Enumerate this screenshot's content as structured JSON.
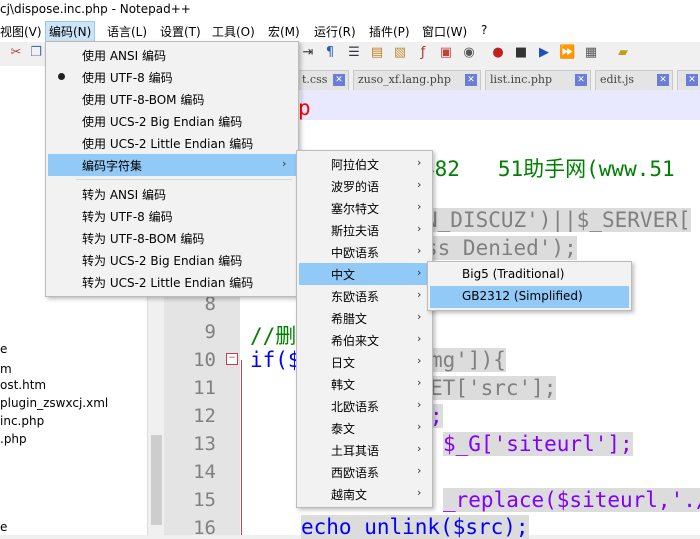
{
  "window": {
    "title": "cj\\dispose.inc.php - Notepad++"
  },
  "menubar": [
    "视图(V)",
    "编码(N)",
    "语言(L)",
    "设置(T)",
    "工具(O)",
    "宏(M)",
    "运行(R)",
    "插件(P)",
    "窗口(W)",
    "?"
  ],
  "tabs": [
    "t.css",
    "zuso_xf.lang.php",
    "list.inc.php",
    "edit.js"
  ],
  "sidebar_files": [
    "e",
    "m",
    "ost.htm",
    "plugin_zswxcj.xml",
    "inc.php",
    ".php",
    "e"
  ],
  "line_numbers": [
    "8",
    "9",
    "10",
    "11",
    "12",
    "13",
    "14",
    "15",
    "16"
  ],
  "code": {
    "l_p": "p",
    "l_482": "482   51助手网(www.51",
    "l_discuz": "N_DISCUZ')||$_SERVER[",
    "l_denied": "ss Denied');",
    "l_comment": "//删",
    "l_if": "if($",
    "l_img": "mg']){",
    "l_src": "ET['src'];",
    "l_semi": ";",
    "l_siteurl": "$_G['siteurl'];",
    "l_replace": "_replace($siteurl,'./",
    "l_unlink": "echo unlink($src);"
  },
  "encoding_menu": {
    "items": [
      "使用 ANSI 编码",
      "使用 UTF-8 编码",
      "使用 UTF-8-BOM 编码",
      "使用 UCS-2 Big Endian 编码",
      "使用 UCS-2 Little Endian 编码",
      "编码字符集",
      "转为 ANSI 编码",
      "转为 UTF-8 编码",
      "转为 UTF-8-BOM 编码",
      "转为 UCS-2 Big Endian 编码",
      "转为 UCS-2 Little Endian 编码"
    ],
    "checked": "使用 UTF-8 编码"
  },
  "charset_menu": [
    "阿拉伯文",
    "波罗的语",
    "塞尔特文",
    "斯拉夫语",
    "中欧语系",
    "中文",
    "东欧语系",
    "希腊文",
    "希伯来文",
    "日文",
    "韩文",
    "北欧语系",
    "泰文",
    "土耳其语",
    "西欧语系",
    "越南文"
  ],
  "chinese_menu": [
    "Big5 (Traditional)",
    "GB2312 (Simplified)"
  ],
  "colors": {
    "highlight": "#91c9f7",
    "keyword_blue": "#0000ff",
    "comment_green": "#008000",
    "string_gray": "#808080",
    "purple": "#8000ff",
    "red_text": "#ff0000"
  }
}
